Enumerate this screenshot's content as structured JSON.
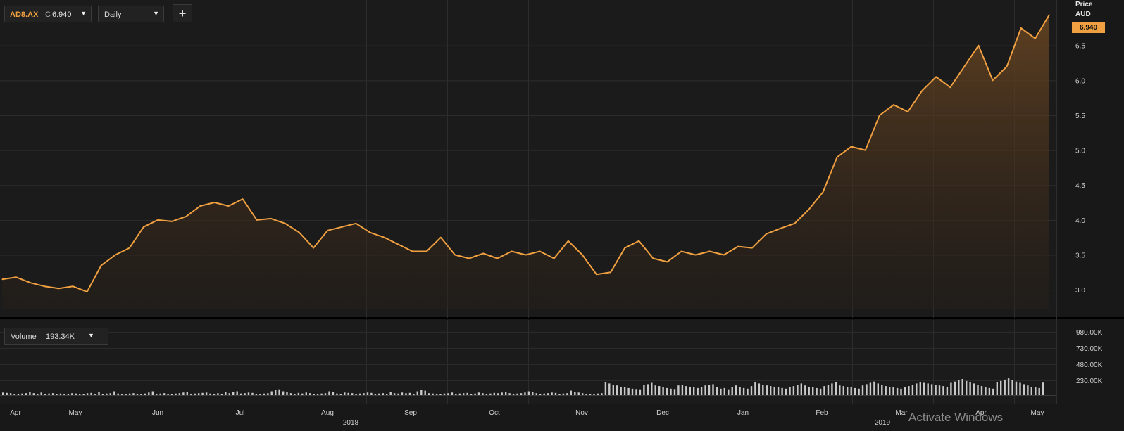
{
  "toolbar": {
    "symbol": "AD8.AX",
    "close_prefix": "C",
    "close_value": "6.940",
    "period": "Daily",
    "add_label": "+"
  },
  "price_axis": {
    "title": "Price",
    "currency": "AUD",
    "last_price_badge": "6.940",
    "ticks": [
      "6.5",
      "6.0",
      "5.5",
      "5.0",
      "4.5",
      "4.0",
      "3.5",
      "3.0"
    ]
  },
  "volume_panel": {
    "label": "Volume",
    "value": "193.34K",
    "ticks": [
      "980.00K",
      "730.00K",
      "480.00K",
      "230.00K"
    ]
  },
  "time_axis": {
    "months": [
      "Apr",
      "May",
      "Jun",
      "Jul",
      "Aug",
      "Sep",
      "Oct",
      "Nov",
      "Dec",
      "Jan",
      "Feb",
      "Mar",
      "Apr",
      "May"
    ],
    "years": [
      "2018",
      "2019"
    ]
  },
  "watermark": "Activate Windows",
  "colors": {
    "line": "#f0a040",
    "area_top": "#6a4622",
    "background": "#1b1b1b",
    "grid": "#2e2e2e",
    "volume_bars": "#c9c9c9"
  },
  "chart_data": [
    {
      "type": "area",
      "x_range": [
        "2018-04-01",
        "2019-05-15"
      ],
      "ylim": [
        2.8,
        6.95
      ],
      "x": [
        "2018-04-01",
        "2018-04-09",
        "2018-04-16",
        "2018-04-23",
        "2018-05-01",
        "2018-05-08",
        "2018-05-15",
        "2018-05-22",
        "2018-05-29",
        "2018-06-05",
        "2018-06-12",
        "2018-06-19",
        "2018-06-26",
        "2018-07-03",
        "2018-07-10",
        "2018-07-17",
        "2018-07-24",
        "2018-07-31",
        "2018-08-07",
        "2018-08-14",
        "2018-08-21",
        "2018-08-28",
        "2018-09-04",
        "2018-09-11",
        "2018-09-18",
        "2018-09-25",
        "2018-10-02",
        "2018-10-09",
        "2018-10-16",
        "2018-10-23",
        "2018-10-30",
        "2018-11-06",
        "2018-11-13",
        "2018-11-20",
        "2018-11-27",
        "2018-12-04",
        "2018-12-11",
        "2018-12-18",
        "2018-12-25",
        "2019-01-01",
        "2019-01-08",
        "2019-01-15",
        "2019-01-22",
        "2019-01-29",
        "2019-02-05",
        "2019-02-12",
        "2019-02-19",
        "2019-02-26",
        "2019-03-05",
        "2019-03-12",
        "2019-03-19",
        "2019-03-26",
        "2019-04-02",
        "2019-04-09",
        "2019-04-16",
        "2019-04-23",
        "2019-04-30",
        "2019-05-07",
        "2019-05-14"
      ],
      "values": [
        3.15,
        3.18,
        3.1,
        3.05,
        3.02,
        3.05,
        2.97,
        3.35,
        3.5,
        3.6,
        3.9,
        4.0,
        3.98,
        4.05,
        4.2,
        4.25,
        4.2,
        4.3,
        4.0,
        4.02,
        3.95,
        3.82,
        3.6,
        3.85,
        3.9,
        3.95,
        3.82,
        3.75,
        3.65,
        3.55,
        3.55,
        3.75,
        3.5,
        3.45,
        3.52,
        3.45,
        3.55,
        3.5,
        3.55,
        3.45,
        3.7,
        3.5,
        3.22,
        3.25,
        3.6,
        3.7,
        3.45,
        3.4,
        3.55,
        3.5,
        3.55,
        3.5,
        3.62,
        3.6,
        3.8,
        3.88,
        3.95,
        4.15,
        4.4,
        4.9,
        5.05,
        5.0,
        5.5,
        5.65,
        5.55,
        5.85,
        6.05,
        5.9,
        6.2,
        6.5,
        6.0,
        6.2,
        6.75,
        6.6,
        6.94
      ],
      "series": [
        {
          "name": "AD8.AX",
          "values_ref": "values"
        }
      ]
    },
    {
      "type": "bar",
      "title": "Volume",
      "ylim": [
        0,
        1000
      ],
      "unit": "K",
      "values": [
        40,
        35,
        30,
        20,
        15,
        25,
        30,
        50,
        30,
        20,
        40,
        20,
        25,
        30,
        20,
        25,
        15,
        20,
        30,
        25,
        20,
        15,
        30,
        35,
        10,
        45,
        20,
        25,
        30,
        60,
        25,
        20,
        15,
        25,
        30,
        20,
        15,
        25,
        40,
        60,
        20,
        25,
        30,
        20,
        15,
        25,
        30,
        40,
        50,
        20,
        25,
        30,
        35,
        40,
        25,
        20,
        30,
        20,
        45,
        30,
        50,
        60,
        25,
        30,
        40,
        35,
        20,
        15,
        25,
        30,
        60,
        80,
        90,
        60,
        45,
        30,
        20,
        35,
        25,
        40,
        30,
        20,
        15,
        25,
        30,
        60,
        45,
        25,
        20,
        40,
        35,
        30,
        20,
        25,
        30,
        40,
        35,
        20,
        25,
        30,
        20,
        45,
        30,
        25,
        40,
        30,
        35,
        20,
        60,
        80,
        70,
        30,
        25,
        20,
        15,
        25,
        30,
        40,
        20,
        25,
        30,
        35,
        20,
        25,
        40,
        30,
        20,
        25,
        35,
        30,
        40,
        50,
        30,
        20,
        25,
        30,
        40,
        60,
        45,
        30,
        20,
        25,
        30,
        40,
        35,
        20,
        25,
        30,
        70,
        50,
        40,
        30,
        20,
        15,
        20,
        25,
        30,
        200,
        180,
        160,
        150,
        130,
        120,
        110,
        100,
        95,
        90,
        160,
        170,
        190,
        150,
        140,
        120,
        110,
        100,
        95,
        150,
        160,
        140,
        130,
        120,
        110,
        130,
        150,
        160,
        170,
        120,
        100,
        110,
        90,
        130,
        150,
        120,
        110,
        100,
        140,
        200,
        180,
        160,
        150,
        140,
        130,
        120,
        110,
        100,
        120,
        140,
        160,
        180,
        150,
        130,
        120,
        110,
        100,
        140,
        160,
        180,
        200,
        150,
        140,
        130,
        120,
        110,
        100,
        150,
        170,
        190,
        210,
        180,
        160,
        140,
        130,
        120,
        110,
        100,
        120,
        140,
        160,
        180,
        200,
        190,
        180,
        170,
        160,
        150,
        140,
        130,
        190,
        210,
        230,
        250,
        220,
        200,
        180,
        160,
        140,
        120,
        110,
        100,
        200,
        220,
        240,
        260,
        230,
        210,
        190,
        170,
        150,
        130,
        120,
        110,
        193
      ]
    }
  ]
}
